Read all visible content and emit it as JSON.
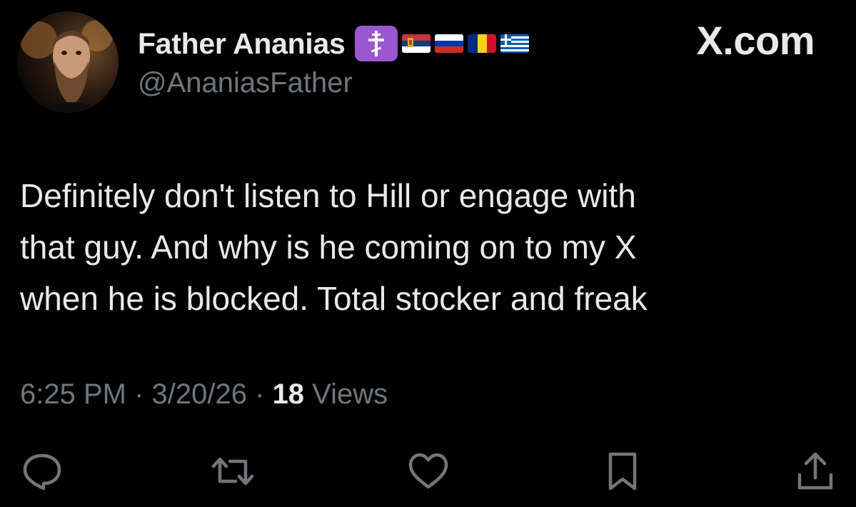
{
  "author": {
    "display_name": "Father Ananias",
    "handle": "@AnaniasFather",
    "badges": [
      "orthodox-cross-icon",
      "serbia-flag-icon",
      "russia-flag-icon",
      "romania-flag-icon",
      "greece-flag-icon"
    ]
  },
  "brand": "X.com",
  "tweet": {
    "text": "Definitely don't listen to Hill or engage with\nthat guy. And why is he coming on to my X\nwhen he is blocked. Total stocker and freak",
    "time": "6:25 PM",
    "date": "3/20/26",
    "separator": "·",
    "views_count": "18",
    "views_label": "Views"
  },
  "actions": [
    "reply-icon",
    "repost-icon",
    "like-icon",
    "bookmark-icon",
    "share-icon"
  ],
  "colors": {
    "background": "#000000",
    "primary_text": "#e7e9ea",
    "secondary_text": "#71767b",
    "badge_purple": "#9b57d0"
  }
}
